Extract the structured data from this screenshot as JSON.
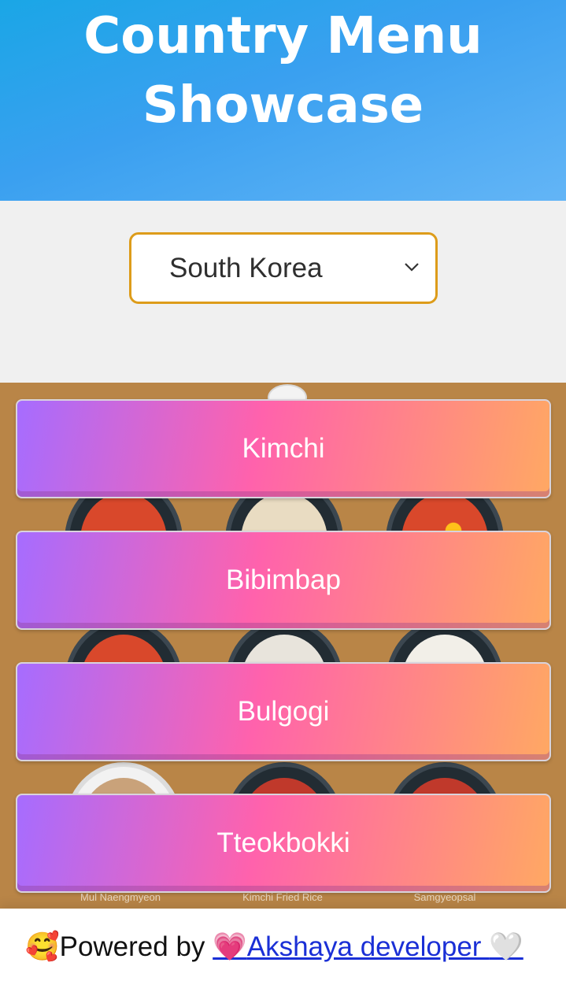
{
  "header": {
    "title_line1": "Country Menu",
    "title_line2": "Showcase",
    "gradient_colors": [
      "#1aa6e6",
      "#63b5f6"
    ]
  },
  "country_select": {
    "selected": "South Korea"
  },
  "menu": {
    "items": [
      {
        "label": "Kimchi"
      },
      {
        "label": "Bibimbap"
      },
      {
        "label": "Bulgogi"
      },
      {
        "label": "Tteokbokki"
      }
    ],
    "button_gradient": [
      "#a66cff",
      "#ff62ac",
      "#ffa863"
    ]
  },
  "background_dishes": {
    "labels": [
      "Mul Naengmyeon",
      "Kimchi Fried Rice",
      "Samgyeopsal"
    ]
  },
  "footer": {
    "powered_by": "Powered by ",
    "author_link": "Akshaya developer ",
    "emoji_smile": "🥰",
    "emoji_heart_pink": "💗",
    "emoji_heart_white": "🤍"
  },
  "colors": {
    "select_border": "#dd9c1a",
    "page_background": "#f0f0f0",
    "food_background": "#b98547",
    "link": "#1a2fd6"
  }
}
